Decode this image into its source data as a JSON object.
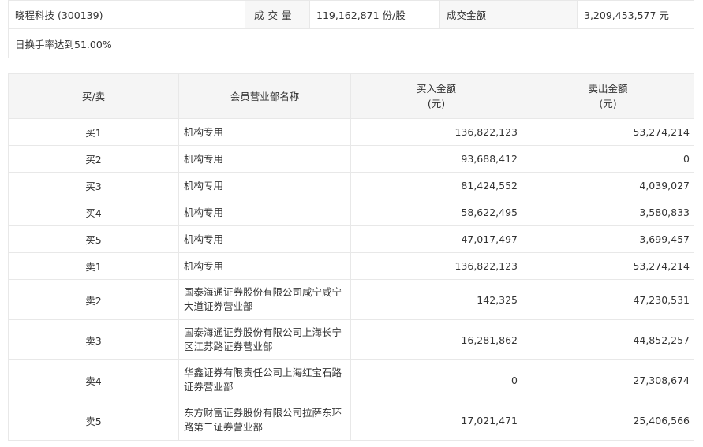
{
  "summary": {
    "stock": "晓程科技 (300139)",
    "volume_label": "成交量",
    "volume_value": "119,162,871 份/股",
    "amount_label": "成交金额",
    "amount_value": "3,209,453,577 元",
    "reason": "日换手率达到51.00%"
  },
  "table": {
    "headers": {
      "side": "买/卖",
      "branch": "会员营业部名称",
      "buy_amount": "买入金额",
      "buy_unit": "(元)",
      "sell_amount": "卖出金额",
      "sell_unit": "(元)"
    },
    "rows": [
      {
        "side": "买1",
        "branch": "机构专用",
        "buy": "136,822,123",
        "sell": "53,274,214"
      },
      {
        "side": "买2",
        "branch": "机构专用",
        "buy": "93,688,412",
        "sell": "0"
      },
      {
        "side": "买3",
        "branch": "机构专用",
        "buy": "81,424,552",
        "sell": "4,039,027"
      },
      {
        "side": "买4",
        "branch": "机构专用",
        "buy": "58,622,495",
        "sell": "3,580,833"
      },
      {
        "side": "买5",
        "branch": "机构专用",
        "buy": "47,017,497",
        "sell": "3,699,457"
      },
      {
        "side": "卖1",
        "branch": "机构专用",
        "buy": "136,822,123",
        "sell": "53,274,214"
      },
      {
        "side": "卖2",
        "branch": "国泰海通证券股份有限公司咸宁咸宁大道证券营业部",
        "buy": "142,325",
        "sell": "47,230,531"
      },
      {
        "side": "卖3",
        "branch": "国泰海通证券股份有限公司上海长宁区江苏路证券营业部",
        "buy": "16,281,862",
        "sell": "44,852,257"
      },
      {
        "side": "卖4",
        "branch": "华鑫证券有限责任公司上海红宝石路证券营业部",
        "buy": "0",
        "sell": "27,308,674"
      },
      {
        "side": "卖5",
        "branch": "东方财富证券股份有限公司拉萨东环路第二证券营业部",
        "buy": "17,021,471",
        "sell": "25,406,566"
      }
    ]
  }
}
